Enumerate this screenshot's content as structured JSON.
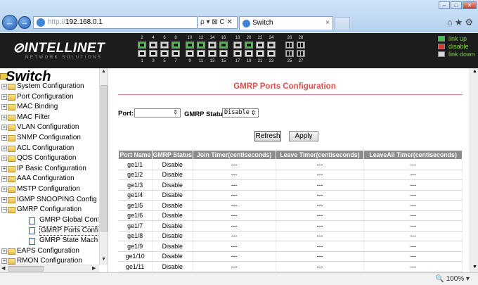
{
  "browser": {
    "address_dim": "http://",
    "address_host": "192.168.0.1",
    "address_tools": "ρ ▾ ⊠ C ✕",
    "tab_title": "Switch",
    "tab_close": "×",
    "zoom": "100%"
  },
  "header": {
    "logo": "INTELLINET",
    "logo_sub": "NETWORK SOLUTIONS",
    "ports_top_numbers": [
      "2",
      "4",
      "6",
      "8",
      "10",
      "12",
      "14",
      "16",
      "18",
      "20",
      "22",
      "24",
      "26",
      "28"
    ],
    "ports_bottom_numbers": [
      "1",
      "3",
      "5",
      "7",
      "9",
      "11",
      "13",
      "15",
      "17",
      "19",
      "21",
      "23",
      "25",
      "27"
    ],
    "legend": [
      "link up",
      "disable",
      "link down"
    ]
  },
  "sidebar": {
    "title": "Switch",
    "items": [
      {
        "label": "System Configuration",
        "type": "folder"
      },
      {
        "label": "Port Configuration",
        "type": "folder"
      },
      {
        "label": "MAC Binding",
        "type": "folder"
      },
      {
        "label": "MAC Filter",
        "type": "folder"
      },
      {
        "label": "VLAN Configuration",
        "type": "folder"
      },
      {
        "label": "SNMP Configuration",
        "type": "folder"
      },
      {
        "label": "ACL Configuration",
        "type": "folder"
      },
      {
        "label": "QOS Configuration",
        "type": "folder"
      },
      {
        "label": "IP Basic Configuration",
        "type": "folder"
      },
      {
        "label": "AAA Configuration",
        "type": "folder"
      },
      {
        "label": "MSTP Configuration",
        "type": "folder"
      },
      {
        "label": "IGMP SNOOPING Config",
        "type": "folder"
      },
      {
        "label": "GMRP Configuration",
        "type": "open"
      },
      {
        "label": "GMRP Global Configur",
        "type": "page"
      },
      {
        "label": "GMRP Ports Configura",
        "type": "page-selected"
      },
      {
        "label": "GMRP State Machine",
        "type": "page"
      },
      {
        "label": "EAPS Configuration",
        "type": "folder"
      },
      {
        "label": "RMON Configuration",
        "type": "folder"
      }
    ]
  },
  "main": {
    "title": "GMRP Ports Configuration",
    "port_label": "Port:",
    "port_value": "",
    "gmrp_status_label": "GMRP Status:",
    "gmrp_status_value": "Disable",
    "refresh_label": "Refresh",
    "apply_label": "Apply",
    "table": {
      "headers": [
        "Port Name",
        "GMRP Status",
        "Join Timer(centiseconds)",
        "Leave Timer(centiseconds)",
        "LeaveAll Timer(centiseconds)"
      ],
      "rows": [
        [
          "ge1/1",
          "Disable",
          "---",
          "---",
          "---"
        ],
        [
          "ge1/2",
          "Disable",
          "---",
          "---",
          "---"
        ],
        [
          "ge1/3",
          "Disable",
          "---",
          "---",
          "---"
        ],
        [
          "ge1/4",
          "Disable",
          "---",
          "---",
          "---"
        ],
        [
          "ge1/5",
          "Disable",
          "---",
          "---",
          "---"
        ],
        [
          "ge1/6",
          "Disable",
          "---",
          "---",
          "---"
        ],
        [
          "ge1/7",
          "Disable",
          "---",
          "---",
          "---"
        ],
        [
          "ge1/8",
          "Disable",
          "---",
          "---",
          "---"
        ],
        [
          "ge1/9",
          "Disable",
          "---",
          "---",
          "---"
        ],
        [
          "ge1/10",
          "Disable",
          "---",
          "---",
          "---"
        ],
        [
          "ge1/11",
          "Disable",
          "---",
          "---",
          "---"
        ]
      ]
    }
  },
  "colors": {
    "title_red": "#d9534f",
    "header_bg": "#1c1c1c",
    "table_header": "#8c8c8c",
    "legend_green": "#7cd23b"
  }
}
